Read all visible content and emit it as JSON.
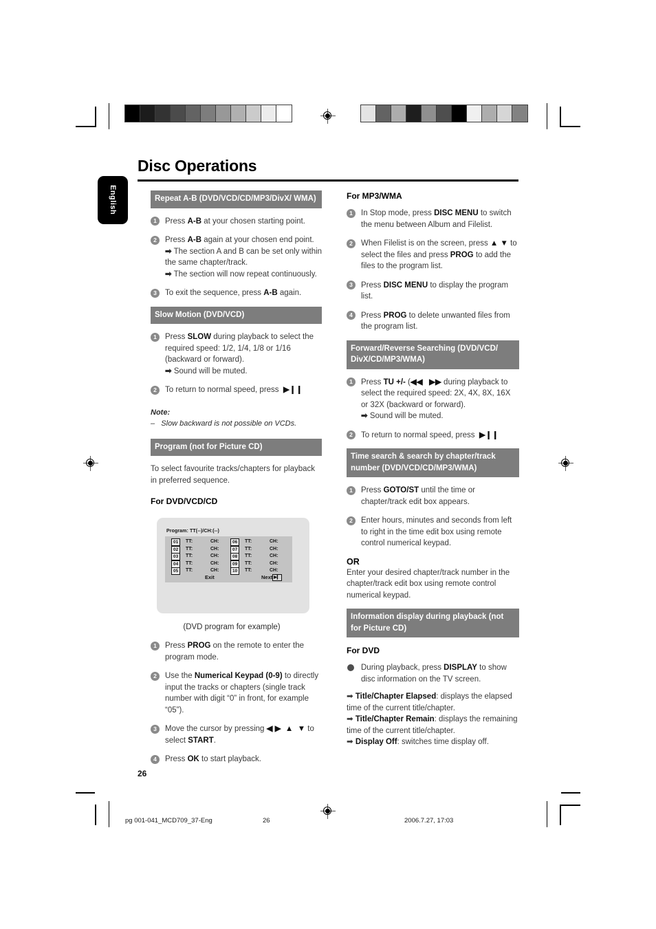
{
  "document": {
    "title": "Disc Operations",
    "language_tab": "English",
    "page_number": "26"
  },
  "footer": {
    "file": "pg 001-041_MCD709_37-Eng",
    "page": "26",
    "date": "2006.7.27, 17:03"
  },
  "calibration": {
    "left_bar": [
      "#000000",
      "#1c1c1c",
      "#333333",
      "#4b4b4b",
      "#636363",
      "#7d7d7d",
      "#989898",
      "#b0b0b0",
      "#cbcbcb",
      "#ececec",
      "#ffffff"
    ],
    "right_bar": [
      "#e4e4e4",
      "#636363",
      "#adadad",
      "#1e1e1e",
      "#8f8f8f",
      "#4e4e4e",
      "#000000",
      "#f0f0f0",
      "#adadad",
      "#d6d6d6",
      "#828282"
    ]
  },
  "colors": {
    "header_bar": "#7d7d7d",
    "header_text": "#ffffff",
    "body_text": "#3a3a3a",
    "bullet": "#8a8a8a",
    "osd_outer": "#e2e2e2",
    "osd_panel": "#c3c3c3"
  },
  "left_column": {
    "sections": [
      {
        "header": "Repeat A-B (DVD/VCD/CD/MP3/DivX/ WMA)",
        "steps": [
          {
            "num": "1",
            "html": "Press <b>A-B</b> at your chosen starting point."
          },
          {
            "num": "2",
            "html": "Press <b>A-B</b> again at your chosen end point.<span class=\"arrow-line\"><span class=\"arr\">&#10145;</span> The section A and B can be set only within the same chapter/track.</span><span class=\"arrow-line\"><span class=\"arr\">&#10145;</span> The section will now repeat continuously.</span>"
          },
          {
            "num": "3",
            "html": "To exit the sequence, press <b>A-B</b> again."
          }
        ]
      },
      {
        "header": "Slow Motion (DVD/VCD)",
        "steps": [
          {
            "num": "1",
            "html": "Press <b>SLOW</b> during playback to select the required speed: 1/2, 1/4, 1/8 or 1/16 (backward or forward).<span class=\"arrow-line\"><span class=\"arr\">&#10145;</span> Sound will be muted.</span>"
          },
          {
            "num": "2",
            "html": "To return to normal speed, press&nbsp; <b>&#9654;&#10073;&#10073;</b>"
          }
        ],
        "note_title": "Note:",
        "note_item": "–   Slow backward is not possible on VCDs."
      },
      {
        "header": "Program (not for Picture CD)",
        "intro": "To select favourite tracks/chapters for playback in preferred sequence.",
        "sub_head": "For DVD/VCD/CD",
        "osd": {
          "title": "Program: TT(--)/CH:(--)",
          "rows": [
            {
              "left_index": "01",
              "left_tt": "TT:",
              "left_ch": "CH:",
              "right_index": "06",
              "right_tt": "TT:",
              "right_ch": "CH:"
            },
            {
              "left_index": "02",
              "left_tt": "TT:",
              "left_ch": "CH:",
              "right_index": "07",
              "right_tt": "TT:",
              "right_ch": "CH:"
            },
            {
              "left_index": "03",
              "left_tt": "TT:",
              "left_ch": "CH:",
              "right_index": "08",
              "right_tt": "TT:",
              "right_ch": "CH:"
            },
            {
              "left_index": "04",
              "left_tt": "TT:",
              "left_ch": "CH:",
              "right_index": "09",
              "right_tt": "TT:",
              "right_ch": "CH:"
            },
            {
              "left_index": "05",
              "left_tt": "TT:",
              "left_ch": "CH:",
              "right_index": "10",
              "right_tt": "TT:",
              "right_ch": "CH:"
            }
          ],
          "exit_label": "Exit",
          "next_label": "Next"
        },
        "caption": "(DVD program for example)",
        "steps": [
          {
            "num": "1",
            "html": "Press <b>PROG</b> on the remote to enter the program mode."
          },
          {
            "num": "2",
            "html": "Use the <b>Numerical Keypad (0-9)</b> to directly input the tracks or chapters (single track number with digit “0” in front, for example “05”)."
          },
          {
            "num": "3",
            "html": "Move the cursor by pressing <b>&#9664; &#9654;&nbsp; &#9650;&nbsp; &#9660;</b> to select <b>START</b>."
          },
          {
            "num": "4",
            "html": "Press <b>OK</b> to start playback."
          }
        ]
      }
    ]
  },
  "right_column": {
    "sections": [
      {
        "sub_head": "For MP3/WMA",
        "steps": [
          {
            "num": "1",
            "html": "In Stop mode, press <b>DISC MENU</b> to switch the menu between Album and Filelist."
          },
          {
            "num": "2",
            "html": "When Filelist is on the screen, press <b>&#9650;&nbsp;&#9660;</b> to select the files and press <b>PROG</b> to add the files to the program list."
          },
          {
            "num": "3",
            "html": "Press <b>DISC MENU</b> to display the program list."
          },
          {
            "num": "4",
            "html": "Press <b>PROG</b> to delete unwanted files from the program list."
          }
        ]
      },
      {
        "header": "Forward/Reverse Searching (DVD/VCD/ DivX/CD/MP3/WMA)",
        "steps": [
          {
            "num": "1",
            "html": "Press <b>TU +/-</b> (<b>&#9664;&#9664;&nbsp;&nbsp; &#9654;&#9654;</b> during playback to select the required speed: 2X, 4X, 8X, 16X or 32X (backward or forward).<span class=\"arrow-line\"><span class=\"arr\">&#10145;</span> Sound will be muted.</span>"
          },
          {
            "num": "2",
            "html": "To return to normal speed, press&nbsp; <b>&#9654;&#10073;&#10073;</b>"
          }
        ]
      },
      {
        "header": "Time search &amp; search by chapter/track number (DVD/VCD/CD/MP3/WMA)",
        "steps": [
          {
            "num": "1",
            "html": "Press <b>GOTO/ST</b> until the time or chapter/track edit box appears."
          },
          {
            "num": "2",
            "html": "Enter hours, minutes and seconds from left to right in the time edit box using remote control numerical keypad."
          }
        ],
        "or_head": "OR",
        "or_text": "Enter your desired chapter/track number in the chapter/track edit box using remote control numerical keypad."
      },
      {
        "header": "Information display during playback (not for Picture CD)",
        "bullet": "During playback, press <b>DISPLAY</b> to show disc information on the TV screen.",
        "sub_head": "For DVD",
        "arrows": [
          "<span class=\"arr\">&#10145;</span> <b>Title/Chapter Elapsed</b>: displays the elapsed time of the current title/chapter.",
          "<span class=\"arr\">&#10145;</span> <b>Title/Chapter Remain</b>: displays the remaining time of the current title/chapter.",
          "<span class=\"arr\">&#10145;</span> <b>Display Off</b>: switches time display off."
        ]
      }
    ]
  }
}
